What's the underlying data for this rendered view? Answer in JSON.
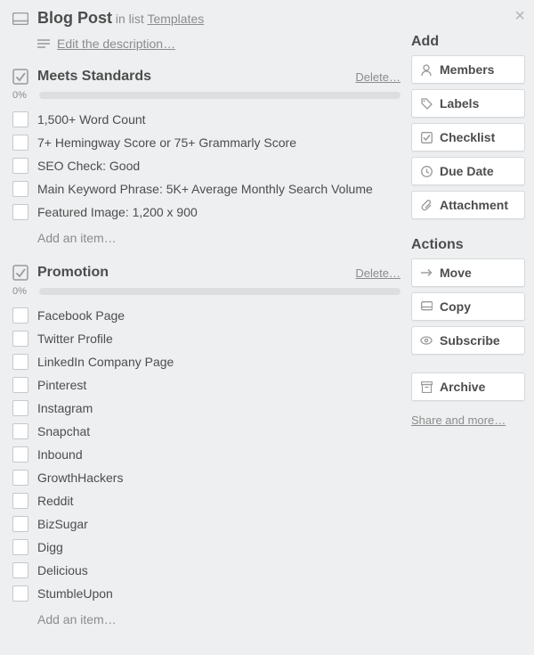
{
  "header": {
    "title": "Blog Post",
    "in_list_prefix": "in list",
    "list_name": "Templates"
  },
  "description": {
    "edit_link": "Edit the description…"
  },
  "checklists": [
    {
      "title": "Meets Standards",
      "delete_label": "Delete…",
      "percent": "0%",
      "items": [
        "1,500+ Word Count",
        "7+ Hemingway Score or 75+ Grammarly Score",
        "SEO Check: Good",
        "Main Keyword Phrase: 5K+ Average Monthly Search Volume",
        "Featured Image: 1,200 x 900"
      ],
      "add_label": "Add an item…"
    },
    {
      "title": "Promotion",
      "delete_label": "Delete…",
      "percent": "0%",
      "items": [
        "Facebook Page",
        "Twitter Profile",
        "LinkedIn Company Page",
        "Pinterest",
        "Instagram",
        "Snapchat",
        "Inbound",
        "GrowthHackers",
        "Reddit",
        "BizSugar",
        "Digg",
        "Delicious",
        "StumbleUpon"
      ],
      "add_label": "Add an item…"
    }
  ],
  "sidebar": {
    "add_heading": "Add",
    "add_buttons": [
      {
        "label": "Members",
        "icon": "members-icon"
      },
      {
        "label": "Labels",
        "icon": "labels-icon"
      },
      {
        "label": "Checklist",
        "icon": "checklist-icon"
      },
      {
        "label": "Due Date",
        "icon": "due-date-icon"
      },
      {
        "label": "Attachment",
        "icon": "attachment-icon"
      }
    ],
    "actions_heading": "Actions",
    "action_buttons": [
      {
        "label": "Move",
        "icon": "move-icon"
      },
      {
        "label": "Copy",
        "icon": "copy-icon"
      },
      {
        "label": "Subscribe",
        "icon": "subscribe-icon"
      }
    ],
    "archive": {
      "label": "Archive",
      "icon": "archive-icon"
    },
    "share_label": "Share and more…"
  }
}
